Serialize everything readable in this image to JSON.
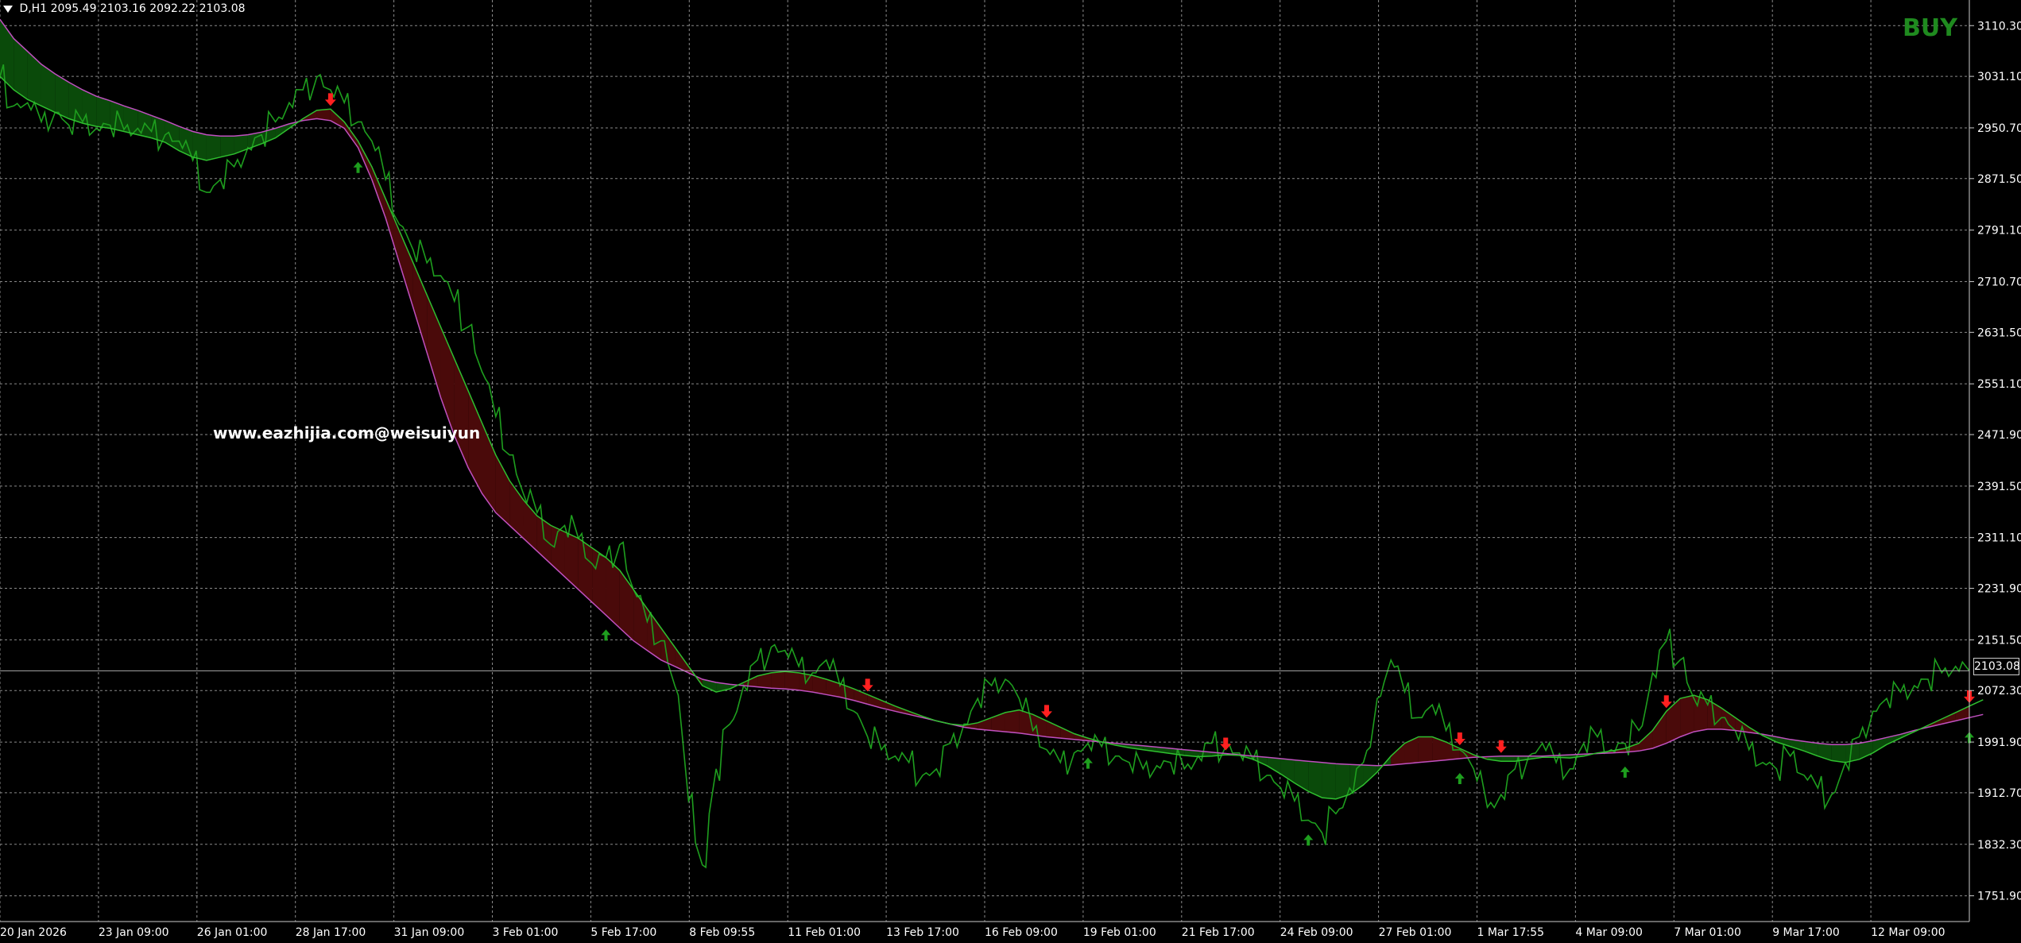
{
  "header": {
    "symbol_timeframe": "D,H1",
    "ohlc": "2095.49 2103.16 2092.22 2103.08"
  },
  "signal_label": "BUY",
  "watermark": "www.eazhijia.com@weisuiyun",
  "current_price": "2103.08",
  "colors": {
    "background": "#000000",
    "grid": "#8a8a8a",
    "price": "#1e9e1e",
    "cloud_green": "#0a4a0a",
    "cloud_red": "#4a0a0a",
    "fast_line": "#2fbf2f",
    "slow_line": "#c050c0",
    "arrow_up": "#1e9e1e",
    "arrow_down": "#ff2020",
    "signal_text": "#1f8a1f"
  },
  "chart_data": {
    "type": "line",
    "title": "",
    "xlabel": "",
    "ylabel": "",
    "ylim": [
      1711.7,
      3150.3
    ],
    "y_ticks": [
      "3110.30",
      "3031.10",
      "2950.70",
      "2871.50",
      "2791.10",
      "2710.70",
      "2631.50",
      "2551.10",
      "2471.90",
      "2391.50",
      "2311.10",
      "2231.90",
      "2151.50",
      "2072.30",
      "1991.90",
      "1912.70",
      "1832.30",
      "1751.90"
    ],
    "x_ticks": [
      "20 Jan 2026",
      "23 Jan 09:00",
      "26 Jan 01:00",
      "28 Jan 17:00",
      "31 Jan 09:00",
      "3 Feb 01:00",
      "5 Feb 17:00",
      "8 Feb 09:55",
      "11 Feb 01:00",
      "13 Feb 17:00",
      "16 Feb 09:00",
      "19 Feb 01:00",
      "21 Feb 17:00",
      "24 Feb 09:00",
      "27 Feb 01:00",
      "1 Mar 17:55",
      "4 Mar 09:00",
      "7 Mar 01:00",
      "9 Mar 17:00",
      "12 Mar 09:00"
    ],
    "grid": true,
    "last_price": 2103.08,
    "series": [
      {
        "name": "",
        "values": [
          3031,
          2985,
          2990,
          2960,
          2975,
          2955,
          2960,
          2950,
          2955,
          2948,
          2950,
          2945,
          2940,
          2930,
          2900,
          2850,
          2870,
          2890,
          2920,
          2940,
          2960,
          2990,
          3010,
          3030,
          3010,
          2990,
          2960,
          2930,
          2870,
          2800,
          2760,
          2740,
          2720,
          2680,
          2640,
          2570,
          2500,
          2440,
          2380,
          2350,
          2300,
          2330,
          2310,
          2270,
          2280,
          2300,
          2230,
          2180,
          2150,
          2080,
          1900,
          1800,
          1950,
          2020,
          2080,
          2120,
          2140,
          2135,
          2110,
          2100,
          2120,
          2080,
          2040,
          2000,
          1980,
          1970,
          1960,
          1940,
          1950,
          1990,
          2020,
          2060,
          2080,
          2090,
          2060,
          2010,
          1980,
          1960,
          1975,
          1990,
          1985,
          1970,
          1960,
          1950,
          1955,
          1960,
          1950,
          1970,
          1990,
          1985,
          1975,
          1965,
          1940,
          1920,
          1900,
          1870,
          1850,
          1880,
          1920,
          1960,
          2060,
          2120,
          2070,
          2030,
          2050,
          2010,
          1980,
          1950,
          1890,
          1910,
          1950,
          1970,
          1990,
          1960,
          1950,
          1990,
          2000,
          1980,
          1990,
          2010,
          2100,
          2150,
          2120,
          2060,
          2050,
          2030,
          2010,
          1980,
          1960,
          1950,
          1970,
          1940,
          1920,
          1910,
          1960,
          2000,
          2040,
          2060,
          2070,
          2080,
          2090,
          2100,
          2110,
          2103
        ]
      },
      {
        "name": "",
        "values": [
          3031,
          3010,
          2995,
          2985,
          2975,
          2965,
          2958,
          2953,
          2950,
          2945,
          2940,
          2935,
          2928,
          2915,
          2905,
          2900,
          2905,
          2910,
          2918,
          2926,
          2935,
          2950,
          2965,
          2978,
          2980,
          2960,
          2930,
          2890,
          2840,
          2790,
          2740,
          2690,
          2640,
          2590,
          2540,
          2490,
          2440,
          2400,
          2370,
          2345,
          2330,
          2320,
          2310,
          2295,
          2280,
          2260,
          2230,
          2200,
          2170,
          2140,
          2110,
          2080,
          2070,
          2075,
          2085,
          2095,
          2100,
          2102,
          2100,
          2096,
          2090,
          2083,
          2075,
          2066,
          2057,
          2048,
          2040,
          2032,
          2025,
          2020,
          2018,
          2022,
          2030,
          2038,
          2042,
          2035,
          2025,
          2015,
          2005,
          1998,
          1992,
          1987,
          1983,
          1980,
          1977,
          1974,
          1971,
          1969,
          1970,
          1972,
          1971,
          1965,
          1955,
          1942,
          1928,
          1915,
          1905,
          1903,
          1910,
          1925,
          1945,
          1970,
          1990,
          2000,
          2000,
          1992,
          1982,
          1972,
          1965,
          1962,
          1962,
          1965,
          1968,
          1968,
          1967,
          1970,
          1975,
          1978,
          1982,
          1990,
          2010,
          2040,
          2060,
          2065,
          2058,
          2045,
          2030,
          2015,
          2002,
          1992,
          1985,
          1978,
          1970,
          1963,
          1960,
          1965,
          1975,
          1988,
          1998,
          2008,
          2018,
          2028,
          2038,
          2048,
          2058
        ]
      },
      {
        "name": "",
        "values": [
          3120,
          3090,
          3070,
          3050,
          3035,
          3022,
          3010,
          3000,
          2993,
          2985,
          2978,
          2970,
          2962,
          2953,
          2945,
          2940,
          2938,
          2938,
          2940,
          2944,
          2950,
          2957,
          2962,
          2965,
          2962,
          2950,
          2920,
          2870,
          2810,
          2740,
          2670,
          2600,
          2530,
          2470,
          2420,
          2380,
          2350,
          2330,
          2310,
          2290,
          2270,
          2250,
          2230,
          2210,
          2190,
          2170,
          2150,
          2135,
          2120,
          2110,
          2100,
          2090,
          2085,
          2082,
          2080,
          2078,
          2076,
          2075,
          2073,
          2070,
          2066,
          2062,
          2057,
          2051,
          2045,
          2040,
          2035,
          2030,
          2025,
          2020,
          2015,
          2012,
          2010,
          2008,
          2006,
          2003,
          2000,
          1998,
          1996,
          1994,
          1992,
          1990,
          1988,
          1986,
          1984,
          1982,
          1980,
          1978,
          1976,
          1974,
          1972,
          1970,
          1968,
          1966,
          1964,
          1962,
          1960,
          1958,
          1957,
          1956,
          1955,
          1956,
          1958,
          1960,
          1962,
          1964,
          1966,
          1968,
          1969,
          1970,
          1970,
          1970,
          1970,
          1971,
          1972,
          1973,
          1974,
          1975,
          1976,
          1978,
          1982,
          1990,
          2000,
          2008,
          2012,
          2012,
          2010,
          2007,
          2004,
          2000,
          1996,
          1993,
          1990,
          1988,
          1988,
          1990,
          1994,
          1999,
          2004,
          2010,
          2015,
          2020,
          2025,
          2030,
          2035
        ]
      }
    ],
    "arrows": {
      "up": [
        26,
        44,
        79,
        95,
        106,
        118,
        143
      ],
      "down": [
        24,
        63,
        76,
        89,
        106,
        109,
        121,
        143
      ]
    }
  }
}
